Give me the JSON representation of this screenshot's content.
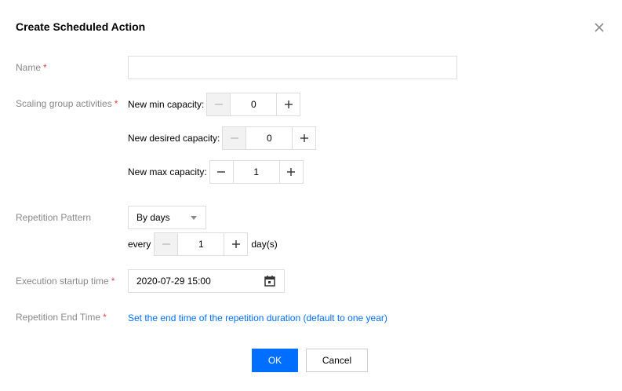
{
  "dialog": {
    "title": "Create Scheduled Action"
  },
  "fields": {
    "name": {
      "label": "Name",
      "required": "*",
      "value": "",
      "placeholder": ""
    },
    "scaling": {
      "label": "Scaling group activities",
      "required": "*",
      "min": {
        "label": "New min capacity:",
        "value": "0",
        "minus_disabled": true
      },
      "desired": {
        "label": "New desired capacity:",
        "value": "0",
        "minus_disabled": true
      },
      "max": {
        "label": "New max capacity:",
        "value": "1",
        "minus_disabled": false
      }
    },
    "repetition": {
      "label": "Repetition Pattern",
      "selected": "By days",
      "every_label": "every",
      "interval_value": "1",
      "unit_label": "day(s)"
    },
    "startup": {
      "label": "Execution startup time",
      "required": "*",
      "value": "2020-07-29 15:00"
    },
    "end_time": {
      "label": "Repetition End Time",
      "required": "*",
      "link": "Set the end time of the repetition duration (default to one year)"
    }
  },
  "buttons": {
    "ok": "OK",
    "cancel": "Cancel"
  },
  "icons": {
    "close": "close-icon",
    "calendar": "calendar-icon",
    "dropdown": "chevron-down-icon",
    "minus": "minus-icon",
    "plus": "plus-icon"
  },
  "colors": {
    "primary": "#006eff",
    "required": "#e54545",
    "label": "#888888",
    "border": "#dddddd"
  }
}
